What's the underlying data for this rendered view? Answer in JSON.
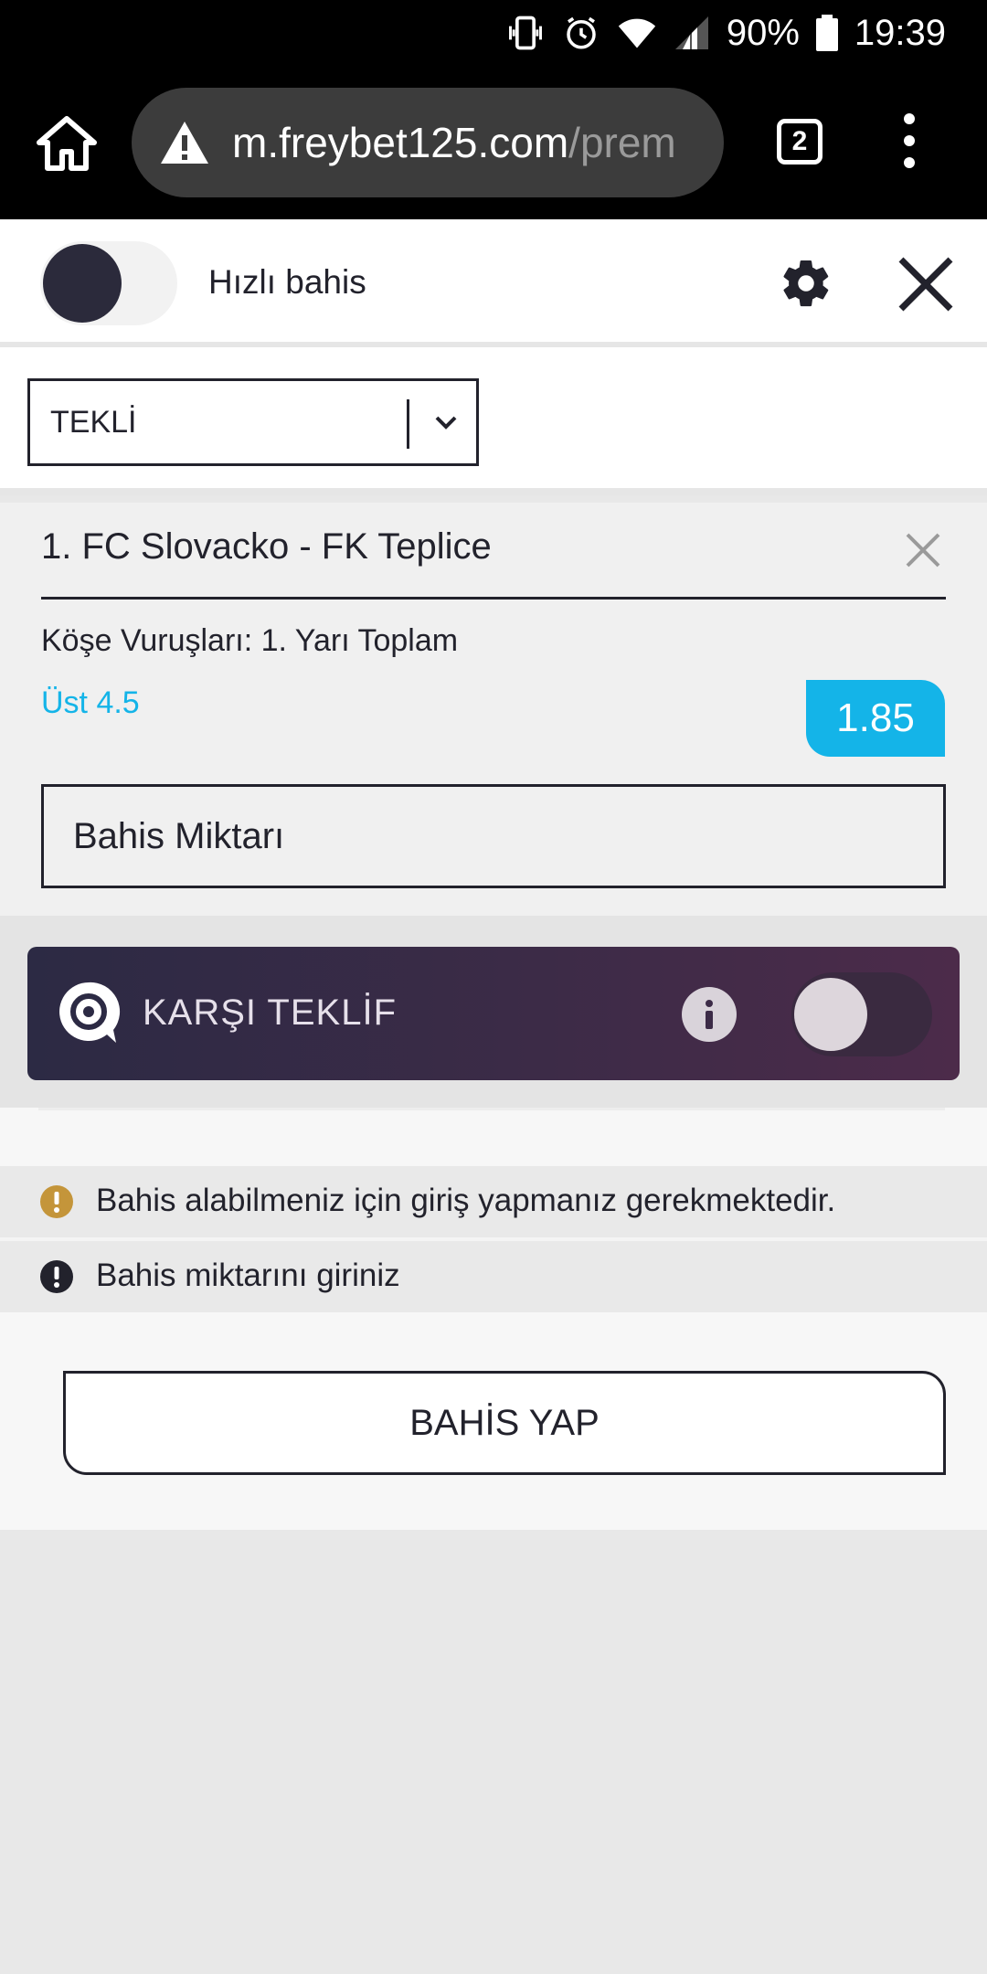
{
  "status_bar": {
    "battery": "90%",
    "time": "19:39"
  },
  "browser": {
    "url_domain": "m.freybet125.com",
    "url_path": "/prem",
    "tab_count": "2"
  },
  "header": {
    "quick_bet_label": "Hızlı bahis"
  },
  "bet_type": {
    "selected": "TEKLİ"
  },
  "bet": {
    "match": "1. FC Slovacko - FK Teplice",
    "market": "Köşe Vuruşları: 1. Yarı Toplam",
    "selection": "Üst 4.5",
    "odds": "1.85",
    "stake_placeholder": "Bahis Miktarı"
  },
  "counter_offer": {
    "label": "KARŞI TEKLİF"
  },
  "messages": {
    "login_required": "Bahis alabilmeniz için giriş yapmanız gerekmektedir.",
    "enter_stake": "Bahis miktarını giriniz"
  },
  "submit": {
    "label": "BAHİS YAP"
  },
  "colors": {
    "accent": "#14b4e8",
    "dark": "#22222c",
    "warning": "#c4953a",
    "offer_bar": "#3c2b47"
  }
}
